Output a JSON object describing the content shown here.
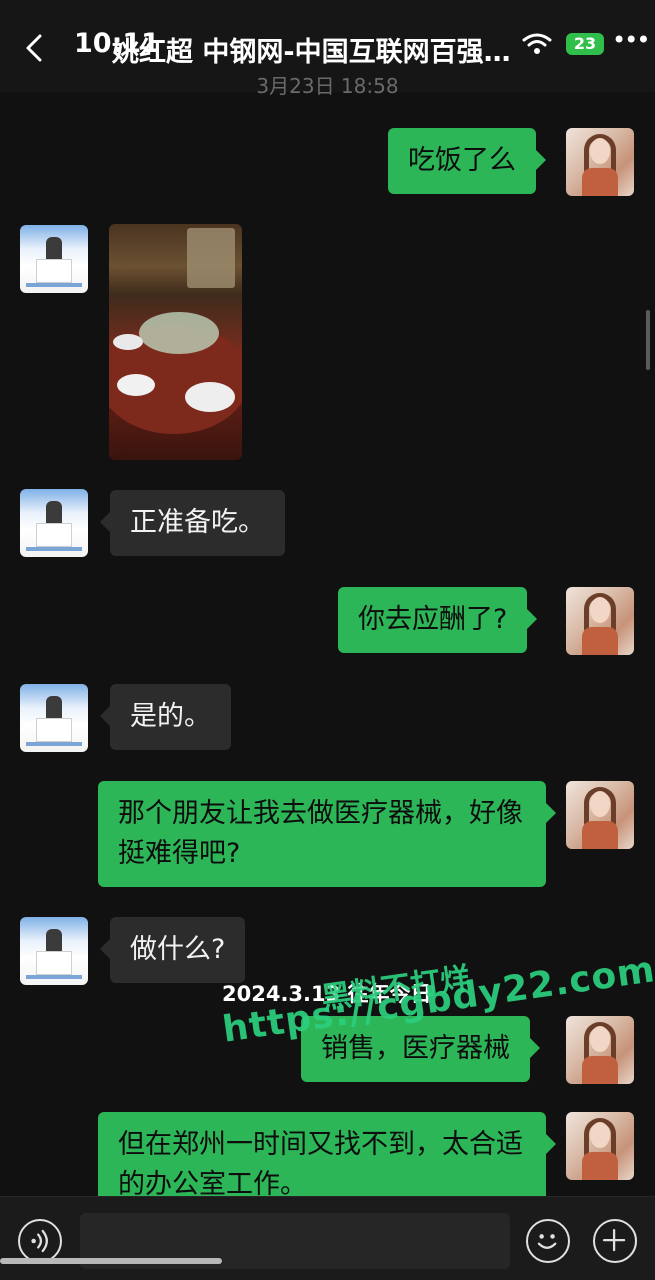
{
  "status_bar": {
    "time": "10:11",
    "battery": "23"
  },
  "header": {
    "title": "姚红超 中钢网-中国互联网百强…"
  },
  "conversation": {
    "timestamp": "3月23日 18:58",
    "messages": [
      {
        "side": "out",
        "type": "text",
        "text": "吃饭了么"
      },
      {
        "side": "in",
        "type": "image",
        "image_desc": "banquet-table-photo"
      },
      {
        "side": "in",
        "type": "text",
        "text": "正准备吃。"
      },
      {
        "side": "out",
        "type": "text",
        "text": "你去应酬了?"
      },
      {
        "side": "in",
        "type": "text",
        "text": "是的。"
      },
      {
        "side": "out",
        "type": "text",
        "text": "那个朋友让我去做医疗器械，好像挺难得吧?"
      },
      {
        "side": "in",
        "type": "text",
        "text": "做什么?"
      },
      {
        "side": "out",
        "type": "text",
        "text": "销售，医疗器械"
      },
      {
        "side": "out",
        "type": "text",
        "text": "但在郑州一时间又找不到，太合适的办公室工作。"
      }
    ]
  },
  "overlay": {
    "date_memory": "2024.3.13 往年今日",
    "watermark_site": "黑料不打烊",
    "watermark_url": "https://cgbdy22.com"
  },
  "input_bar": {
    "placeholder": "",
    "icons": [
      "voice-icon",
      "emoji-icon",
      "plus-icon"
    ]
  },
  "colors": {
    "bg": "#111111",
    "bubble_in": "#2c2c2c",
    "bubble_out": "#2db658",
    "watermark": "#2bd07f"
  }
}
